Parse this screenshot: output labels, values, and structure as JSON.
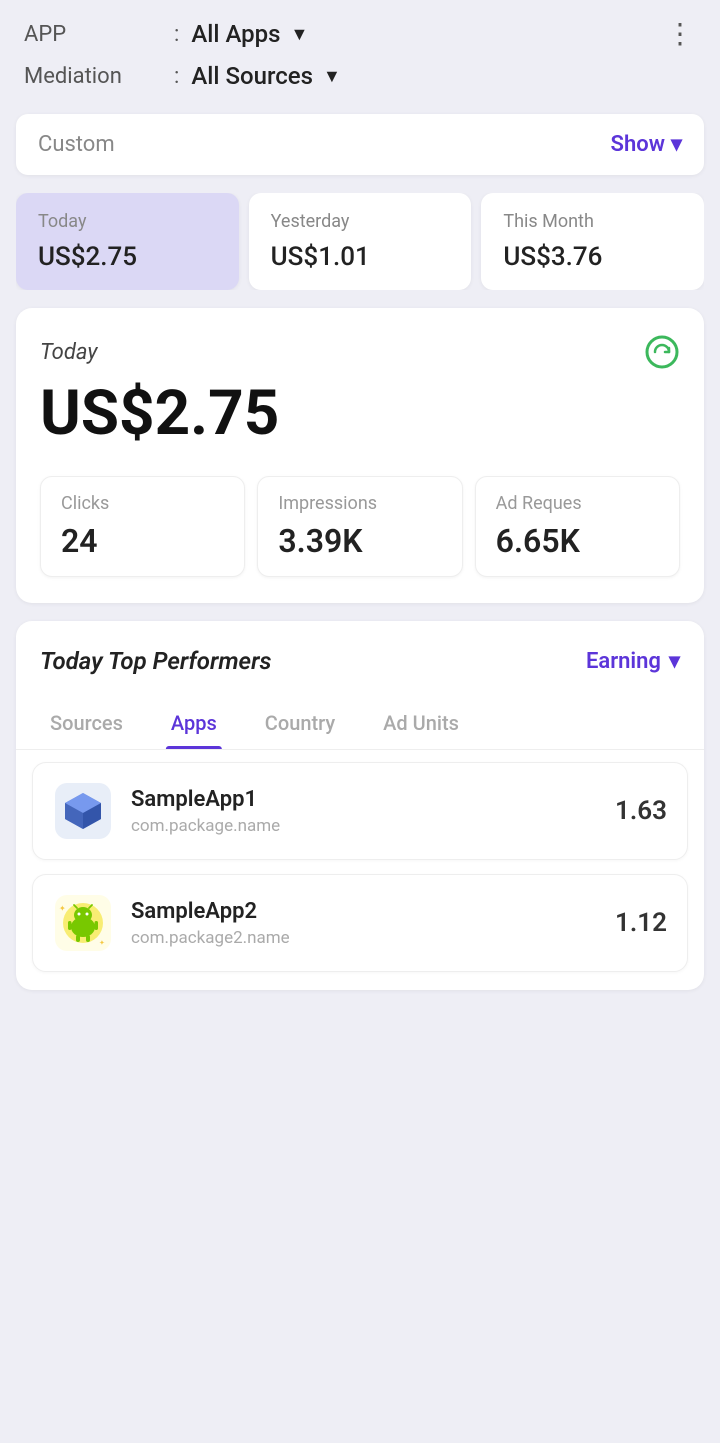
{
  "header": {
    "app_label": "APP",
    "app_colon": ":",
    "app_value": "All Apps",
    "mediation_label": "Mediation",
    "mediation_colon": ":",
    "mediation_value": "All Sources"
  },
  "custom_bar": {
    "label": "Custom",
    "show_label": "Show"
  },
  "period_cards": [
    {
      "label": "Today",
      "value": "US$2.75",
      "active": true
    },
    {
      "label": "Yesterday",
      "value": "US$1.01",
      "active": false
    },
    {
      "label": "This Month",
      "value": "US$3.76",
      "active": false
    }
  ],
  "main_section": {
    "today_label": "Today",
    "amount": "US$2.75",
    "stats": [
      {
        "label": "Clicks",
        "value": "24"
      },
      {
        "label": "Impressions",
        "value": "3.39K"
      },
      {
        "label": "Ad Reques",
        "value": "6.65K"
      }
    ]
  },
  "performers": {
    "title": "Today Top Performers",
    "earning_label": "Earning",
    "tabs": [
      {
        "label": "Sources",
        "active": false
      },
      {
        "label": "Apps",
        "active": true
      },
      {
        "label": "Country",
        "active": false
      },
      {
        "label": "Ad Units",
        "active": false
      }
    ],
    "apps": [
      {
        "name": "SampleApp1",
        "package": "com.package.name",
        "earning": "1.63"
      },
      {
        "name": "SampleApp2",
        "package": "com.package2.name",
        "earning": "1.12"
      }
    ]
  },
  "colors": {
    "accent": "#5c35d9",
    "active_tab_bg": "#dbd8f5",
    "bg": "#eeeef5"
  }
}
